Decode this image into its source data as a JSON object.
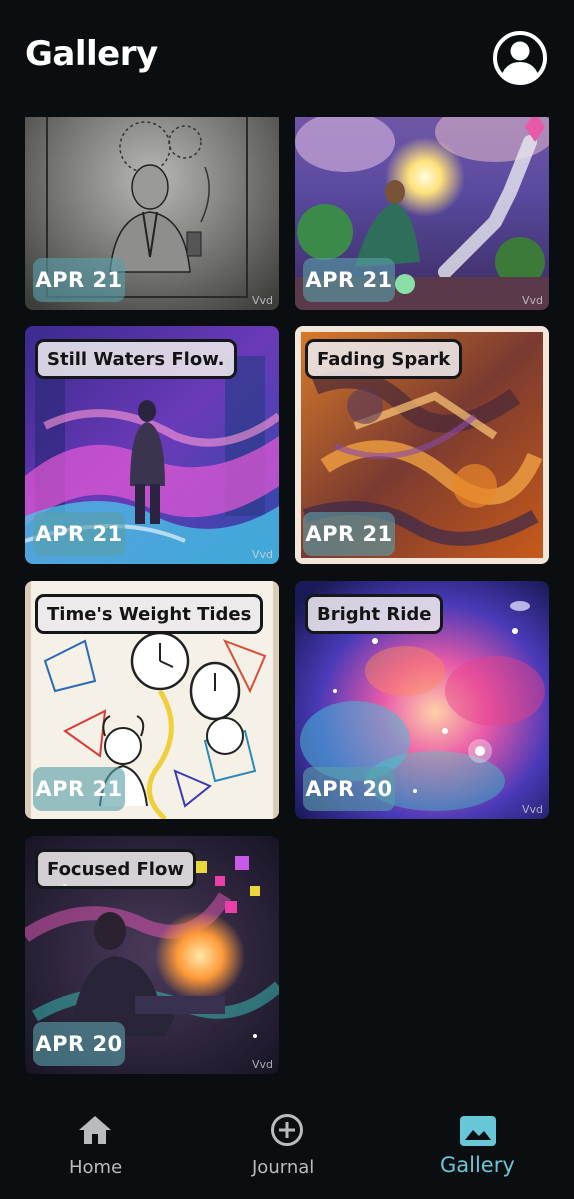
{
  "header": {
    "title": "Gallery",
    "profile_icon": "account-circle-icon"
  },
  "gallery": {
    "cards": [
      {
        "title": "",
        "date": "APR 21",
        "watermark": "Vvd",
        "art": "pencil-sketch-man-with-phone"
      },
      {
        "title": "",
        "date": "APR 21",
        "watermark": "Vvd",
        "art": "wizard-on-glowing-stairway"
      },
      {
        "title": "Still Waters Flow.",
        "date": "APR 21",
        "watermark": "Vvd",
        "art": "man-walking-neon-river"
      },
      {
        "title": "Fading Spark",
        "date": "APR 21",
        "watermark": "",
        "art": "abstract-orange-brushstrokes"
      },
      {
        "title": "Time's Weight Tides",
        "date": "APR 21",
        "watermark": "",
        "art": "stressed-man-clocks-sketch"
      },
      {
        "title": "Bright Ride",
        "date": "APR 20",
        "watermark": "Vvd",
        "art": "colorful-nebula"
      },
      {
        "title": "Focused Flow",
        "date": "APR 20",
        "watermark": "Vvd",
        "art": "man-typing-cosmic-laptop"
      }
    ]
  },
  "nav": {
    "items": [
      {
        "label": "Home",
        "icon": "home-icon",
        "active": false
      },
      {
        "label": "Journal",
        "icon": "add-circle-icon",
        "active": false
      },
      {
        "label": "Gallery",
        "icon": "image-icon",
        "active": true
      }
    ]
  },
  "colors": {
    "background": "#0b0e10",
    "accent": "#67c6d8",
    "inactive": "#b9bcbf"
  }
}
